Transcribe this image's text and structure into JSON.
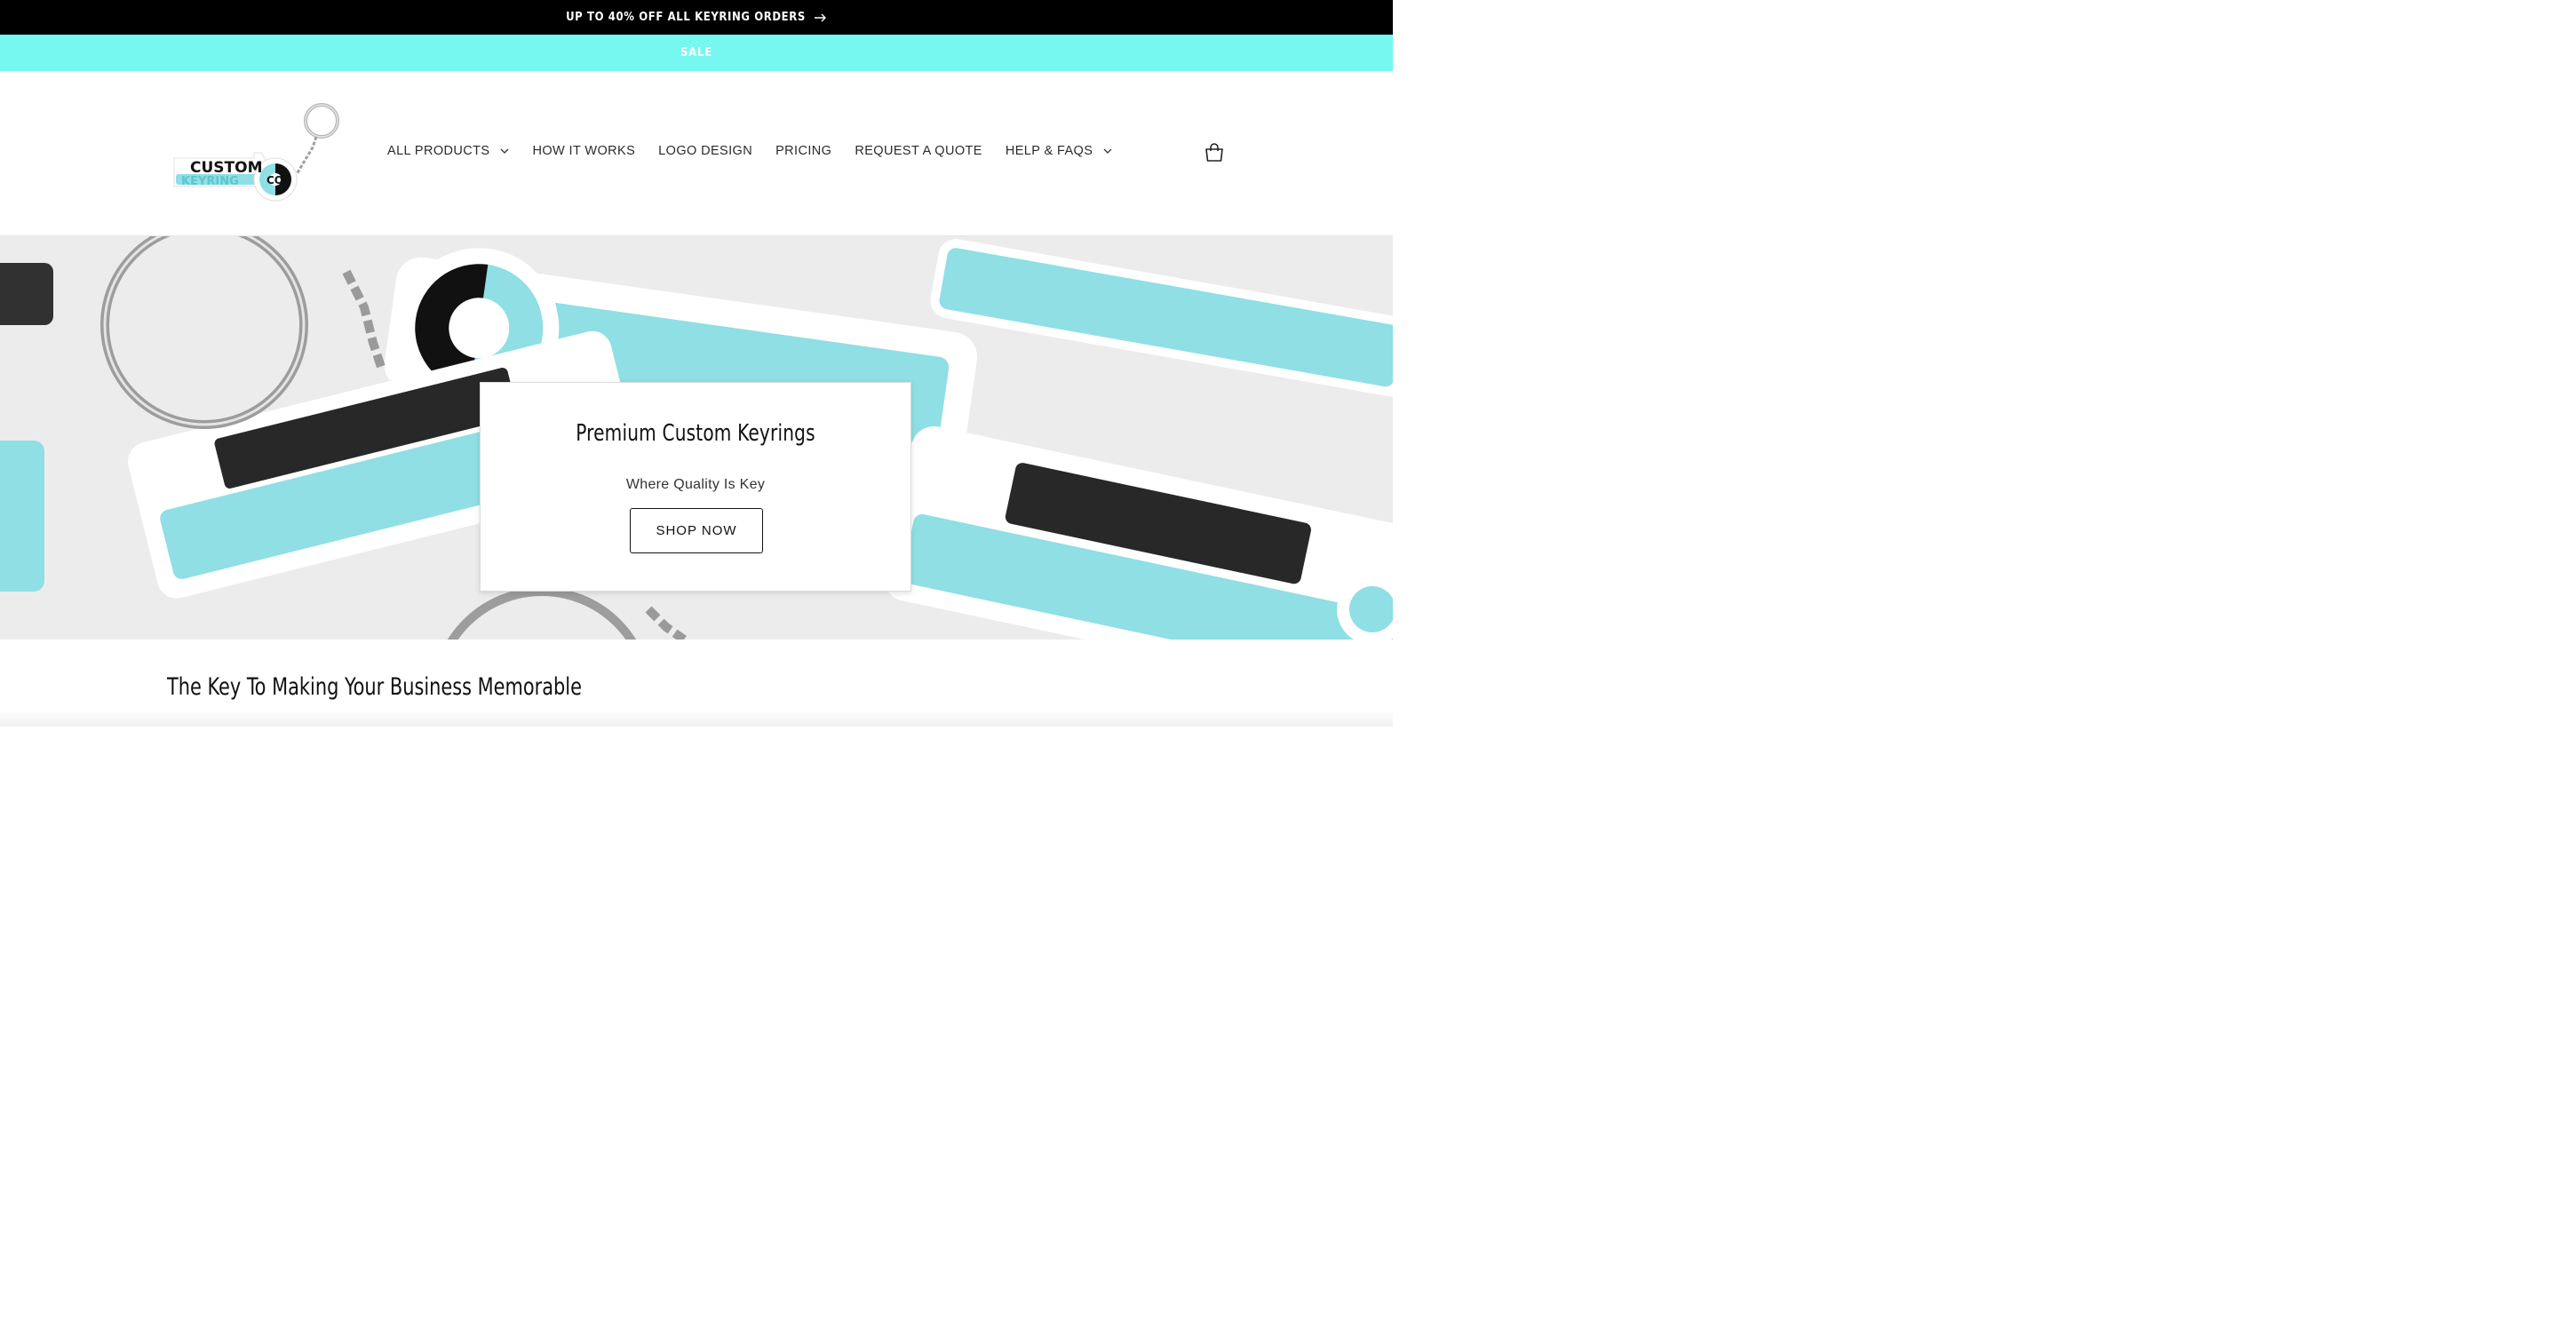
{
  "announcement": {
    "text": "UP TO 40% OFF ALL KEYRING ORDERS"
  },
  "sale_bar": {
    "text": "SALE"
  },
  "logo": {
    "line1": "CUSTOM",
    "line2": "KEYRING",
    "badge": "CO"
  },
  "nav": {
    "items": [
      {
        "label": "ALL PRODUCTS",
        "has_dropdown": true
      },
      {
        "label": "HOW IT WORKS",
        "has_dropdown": false
      },
      {
        "label": "LOGO DESIGN",
        "has_dropdown": false
      },
      {
        "label": "PRICING",
        "has_dropdown": false
      },
      {
        "label": "REQUEST A QUOTE",
        "has_dropdown": false
      },
      {
        "label": "HELP & FAQS",
        "has_dropdown": true
      }
    ]
  },
  "icons": {
    "announcement_arrow": "arrow-right-icon",
    "cart": "cart-icon",
    "dropdown": "chevron-down-icon"
  },
  "hero": {
    "title": "Premium Custom Keyrings",
    "subtitle": "Where Quality Is Key",
    "button_label": "SHOP NOW"
  },
  "section": {
    "heading": "The Key To Making Your Business Memorable"
  },
  "colors": {
    "brand_aqua": "#76f7f0",
    "keyring_blue": "#8fdfe4",
    "black": "#000000"
  }
}
